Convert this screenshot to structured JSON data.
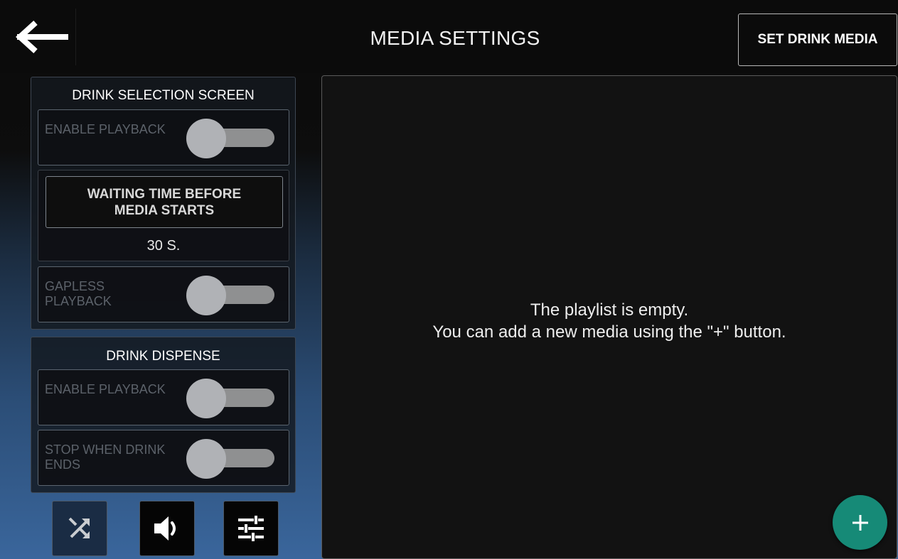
{
  "header": {
    "title": "MEDIA SETTINGS",
    "set_drink_media_label": "SET DRINK MEDIA",
    "back_icon": "arrow-left-icon"
  },
  "drink_selection_screen": {
    "title": "DRINK SELECTION SCREEN",
    "enable_playback": {
      "label": "ENABLE PLAYBACK",
      "state": "off"
    },
    "waiting_time": {
      "label": "WAITING TIME BEFORE MEDIA STARTS",
      "value": "30 S."
    },
    "gapless_playback": {
      "label": "GAPLESS PLAYBACK",
      "state": "off"
    }
  },
  "drink_dispense": {
    "title": "DRINK DISPENSE",
    "enable_playback": {
      "label": "ENABLE PLAYBACK",
      "state": "off"
    },
    "stop_when_drink_ends": {
      "label": "STOP WHEN DRINK ENDS",
      "state": "off"
    }
  },
  "bottom_buttons": [
    {
      "icon": "shuffle-icon"
    },
    {
      "icon": "volume-icon"
    },
    {
      "icon": "sliders-icon"
    }
  ],
  "playlist": {
    "empty_line1": "The playlist is empty.",
    "empty_line2": "You can add a new media using the \"+\" button."
  },
  "add_button": {
    "icon": "plus-icon"
  },
  "colors": {
    "accent": "#168a77",
    "panel_background": "#121212",
    "header_background": "#0b0b0b",
    "gradient_bottom": "#3a669c"
  }
}
